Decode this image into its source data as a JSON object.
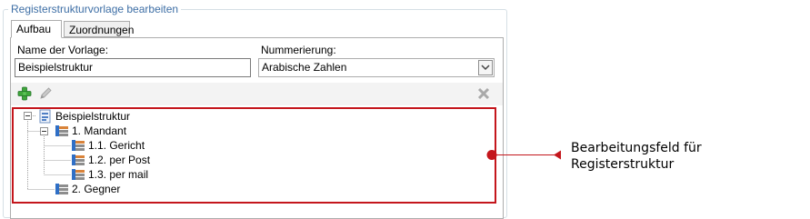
{
  "group": {
    "title": "Registerstrukturvorlage bearbeiten"
  },
  "tabs": [
    {
      "label": "Aufbau",
      "active": true
    },
    {
      "label": "Zuordnungen",
      "active": false
    }
  ],
  "form": {
    "name_label": "Name der Vorlage:",
    "name_value": "Beispielstruktur",
    "numbering_label": "Nummerierung:",
    "numbering_value": "Arabische Zahlen"
  },
  "toolbar": {
    "add_icon": "plus-icon",
    "edit_icon": "pencil-icon",
    "delete_icon": "delete-x-icon"
  },
  "tree": {
    "root": "Beispielstruktur",
    "items": [
      {
        "label": "1. Mandant",
        "level": 1
      },
      {
        "label": "1.1. Gericht",
        "level": 2
      },
      {
        "label": "1.2. per Post",
        "level": 2
      },
      {
        "label": "1.3. per mail",
        "level": 2
      },
      {
        "label": "2. Gegner",
        "level": 1
      }
    ]
  },
  "callout": {
    "line1": "Bearbeitungsfeld für",
    "line2": "Registerstruktur",
    "color": "#c4161c"
  }
}
